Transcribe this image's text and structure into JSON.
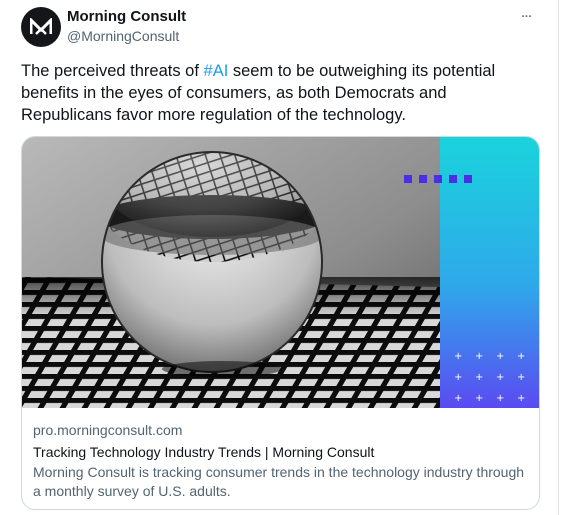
{
  "author": {
    "name": "Morning Consult",
    "handle": "@MorningConsult"
  },
  "tweet": {
    "text_before": "The perceived threats of ",
    "hashtag": "#AI",
    "text_after": " seem to be outweighing its potential benefits in the eyes of consumers, as both Democrats and Republicans favor more regulation of the technology."
  },
  "more_menu": "...",
  "card": {
    "domain": "pro.morningconsult.com",
    "title": "Tracking Technology Industry Trends | Morning Consult",
    "description": "Morning Consult is tracking consumer trends in the technology industry through a monthly survey of U.S. adults."
  },
  "colors": {
    "link": "#1d9bf0",
    "panel_gradient_top": "#1ad3dc",
    "panel_gradient_bottom": "#5a4bf1",
    "square_accent": "#4b2ee6"
  }
}
